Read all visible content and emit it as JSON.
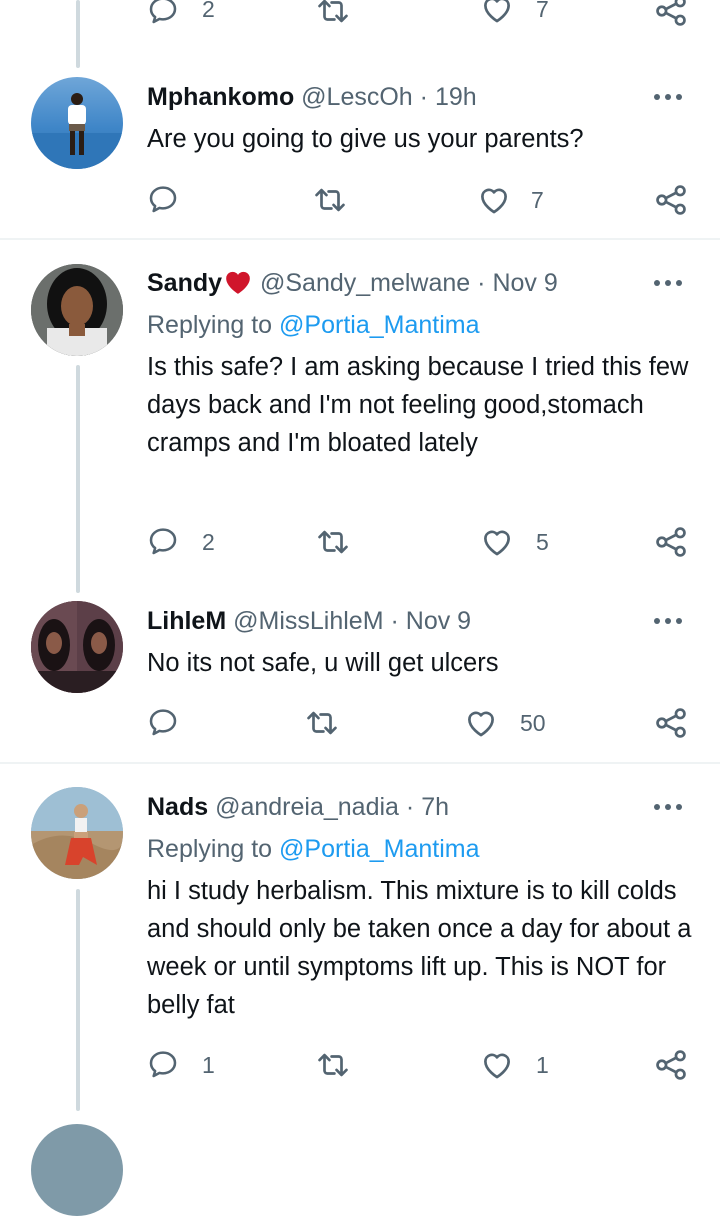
{
  "top_actions": {
    "reply_count": "2",
    "like_count": "7"
  },
  "tweets": [
    {
      "name": "Mphankomo",
      "handle": "@LescOh",
      "time": "19h",
      "text": "Are you going to give us your parents?",
      "reply_count": "",
      "like_count": "7"
    },
    {
      "name": "Sandy",
      "handle": "@Sandy_melwane",
      "time": "Nov 9",
      "replying_prefix": "Replying to",
      "replying_to": "@Portia_Mantima",
      "text": "Is this safe? I am asking because I tried this few days back and I'm not feeling good,stomach cramps and I'm bloated lately",
      "reply_count": "2",
      "like_count": "5"
    },
    {
      "name": "LihleM",
      "handle": "@MissLihleM",
      "time": "Nov 9",
      "text": "No its not safe, u will get ulcers",
      "reply_count": "",
      "like_count": "50"
    },
    {
      "name": "Nads",
      "handle": "@andreia_nadia",
      "time": "7h",
      "replying_prefix": "Replying to",
      "replying_to": "@Portia_Mantima",
      "text": "hi I study herbalism. This mixture is to kill colds and should only be taken once a day for about a week or until symptoms lift up. This is NOT for belly fat",
      "reply_count": "1",
      "like_count": "1"
    }
  ],
  "icons": {
    "reply": "reply-icon",
    "retweet": "retweet-icon",
    "like": "heart-icon",
    "share": "share-icon",
    "more": "more-icon",
    "emoji_heart": "red-heart-icon"
  },
  "colors": {
    "link": "#1d9bf0",
    "muted": "#536471",
    "text": "#0f1419",
    "emoji_heart": "#d0152b"
  }
}
